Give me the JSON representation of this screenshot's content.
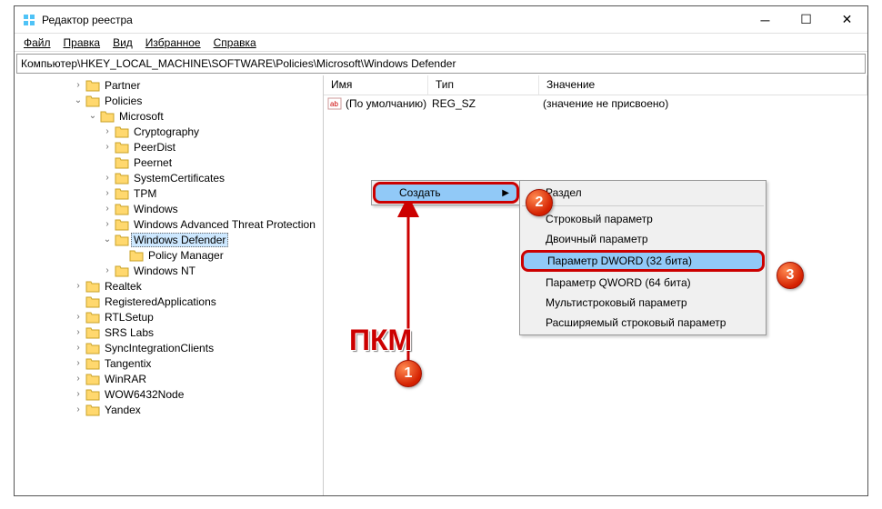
{
  "window": {
    "title": "Редактор реестра"
  },
  "menubar": {
    "file": "Файл",
    "edit": "Правка",
    "view": "Вид",
    "favorites": "Избранное",
    "help": "Справка"
  },
  "addressbar": {
    "path": "Компьютер\\HKEY_LOCAL_MACHINE\\SOFTWARE\\Policies\\Microsoft\\Windows Defender"
  },
  "tree": {
    "partner": "Partner",
    "policies": "Policies",
    "microsoft": "Microsoft",
    "cryptography": "Cryptography",
    "peerdist": "PeerDist",
    "peernet": "Peernet",
    "systemcertificates": "SystemCertificates",
    "tpm": "TPM",
    "windows": "Windows",
    "watp": "Windows Advanced Threat Protection",
    "defender": "Windows Defender",
    "policymgr": "Policy Manager",
    "winnt": "Windows NT",
    "realtek": "Realtek",
    "regapps": "RegisteredApplications",
    "rtlsetup": "RTLSetup",
    "srslabs": "SRS Labs",
    "syncint": "SyncIntegrationClients",
    "tangentix": "Tangentix",
    "winrar": "WinRAR",
    "wow6432": "WOW6432Node",
    "yandex": "Yandex"
  },
  "list": {
    "col_name": "Имя",
    "col_type": "Тип",
    "col_value": "Значение",
    "default_name": "(По умолчанию)",
    "default_type": "REG_SZ",
    "default_value": "(значение не присвоено)"
  },
  "context": {
    "create": "Создать",
    "section": "Раздел",
    "string": "Строковый параметр",
    "binary": "Двоичный параметр",
    "dword": "Параметр DWORD (32 бита)",
    "qword": "Параметр QWORD (64 бита)",
    "multistring": "Мультистроковый параметр",
    "expandstring": "Расширяемый строковый параметр"
  },
  "annotations": {
    "label1": "ПКМ",
    "badge1": "1",
    "badge2": "2",
    "badge3": "3"
  }
}
